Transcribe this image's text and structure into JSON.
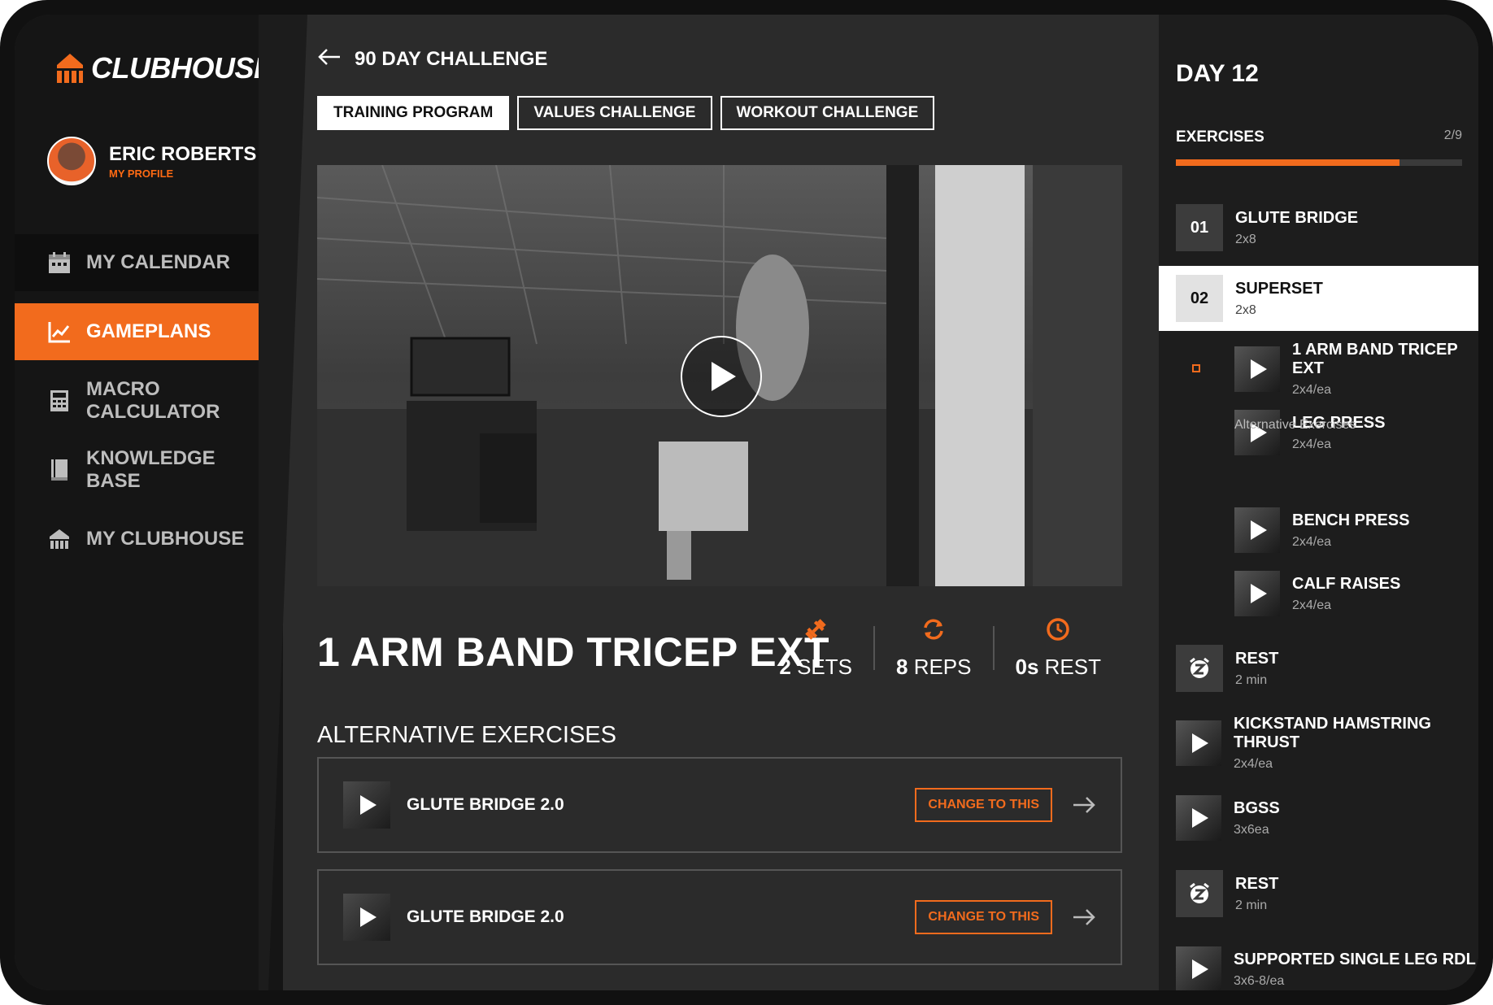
{
  "brand": {
    "name": "CLUBHOUSE",
    "accent": "#f26b1d"
  },
  "profile": {
    "name": "ERIC ROBERTS",
    "link": "MY PROFILE"
  },
  "nav": [
    {
      "label": "MY CALENDAR",
      "icon": "calendar-icon"
    },
    {
      "label": "GAMEPLANS",
      "icon": "chart-icon",
      "active": true
    },
    {
      "label": "MACRO CALCULATOR",
      "icon": "calculator-icon"
    },
    {
      "label": "KNOWLEDGE BASE",
      "icon": "book-icon"
    },
    {
      "label": "MY CLUBHOUSE",
      "icon": "clubhouse-icon"
    }
  ],
  "header": {
    "title": "90 DAY CHALLENGE"
  },
  "tabs": [
    {
      "label": "TRAINING PROGRAM",
      "active": true
    },
    {
      "label": "VALUES CHALLENGE"
    },
    {
      "label": "WORKOUT CHALLENGE"
    }
  ],
  "exercise": {
    "title": "1 ARM BAND TRICEP EXT",
    "sets_value": "2",
    "sets_unit": "SETS",
    "reps_value": "8",
    "reps_unit": "REPS",
    "rest_value": "0s",
    "rest_unit": "REST"
  },
  "alternatives": {
    "heading": "ALTERNATIVE EXERCISES",
    "items": [
      {
        "name": "GLUTE BRIDGE 2.0",
        "button": "CHANGE TO THIS"
      },
      {
        "name": "GLUTE BRIDGE 2.0",
        "button": "CHANGE TO THIS"
      }
    ]
  },
  "day_panel": {
    "day": "DAY 12",
    "exercises_label": "EXERCISES",
    "count": "2/9",
    "progress": 0.78,
    "items": [
      {
        "num": "01",
        "name": "GLUTE BRIDGE",
        "sub": "2x8"
      },
      {
        "num": "02",
        "name": "SUPERSET",
        "sub": "2x8"
      },
      {
        "name": "1 ARM BAND TRICEP EXT",
        "sub": "2x4/ea"
      },
      {
        "name": "LEG PRESS",
        "sub": "2x4/ea"
      },
      {
        "name": "BENCH PRESS",
        "sub": "2x4/ea"
      },
      {
        "name": "CALF RAISES",
        "sub": "2x4/ea"
      },
      {
        "name": "REST",
        "sub": "2 min"
      },
      {
        "name": "KICKSTAND HAMSTRING THRUST",
        "sub": "2x4/ea"
      },
      {
        "name": "BGSS",
        "sub": "3x6ea"
      },
      {
        "name": "REST",
        "sub": "2 min"
      },
      {
        "name": "SUPPORTED SINGLE LEG RDL",
        "sub": "3x6-8/ea"
      }
    ],
    "alt_caption": "Alternative Exercises"
  }
}
